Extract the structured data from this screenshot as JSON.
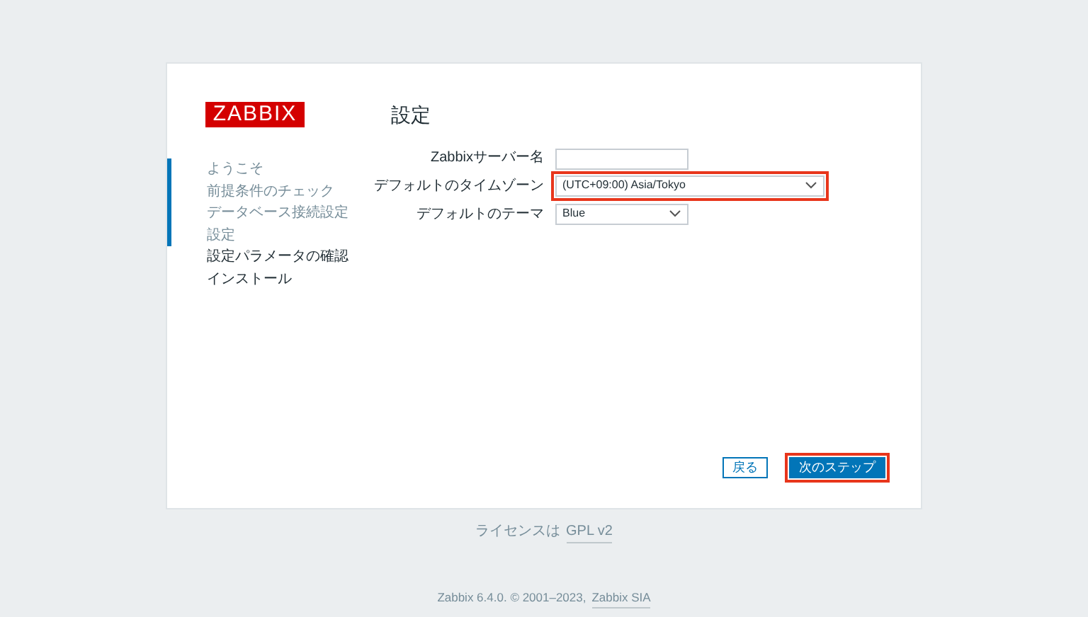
{
  "logo": "ZABBIX",
  "steps": [
    {
      "label": "ようこそ",
      "done": true
    },
    {
      "label": "前提条件のチェック",
      "done": true
    },
    {
      "label": "データベース接続設定",
      "done": true
    },
    {
      "label": "設定",
      "done": true
    },
    {
      "label": "設定パラメータの確認",
      "done": false
    },
    {
      "label": "インストール",
      "done": false
    }
  ],
  "title": "設定",
  "fields": [
    {
      "kind": "text",
      "label": "Zabbixサーバー名",
      "highlighted": false
    },
    {
      "kind": "select",
      "label": "デフォルトのタイムゾーン",
      "value": "(UTC+09:00) Asia/Tokyo",
      "highlighted": true
    },
    {
      "kind": "select",
      "label": "デフォルトのテーマ",
      "value": "Blue",
      "highlighted": false
    }
  ],
  "buttons": [
    {
      "kind": "secondary",
      "label": "戻る",
      "highlighted": false
    },
    {
      "kind": "primary",
      "label": "次のステップ",
      "highlighted": true
    }
  ],
  "license": {
    "text": "ライセンスは",
    "link": "GPL v2"
  },
  "footer": {
    "text": "Zabbix 6.4.0. © 2001–2023,",
    "link": "Zabbix SIA"
  }
}
